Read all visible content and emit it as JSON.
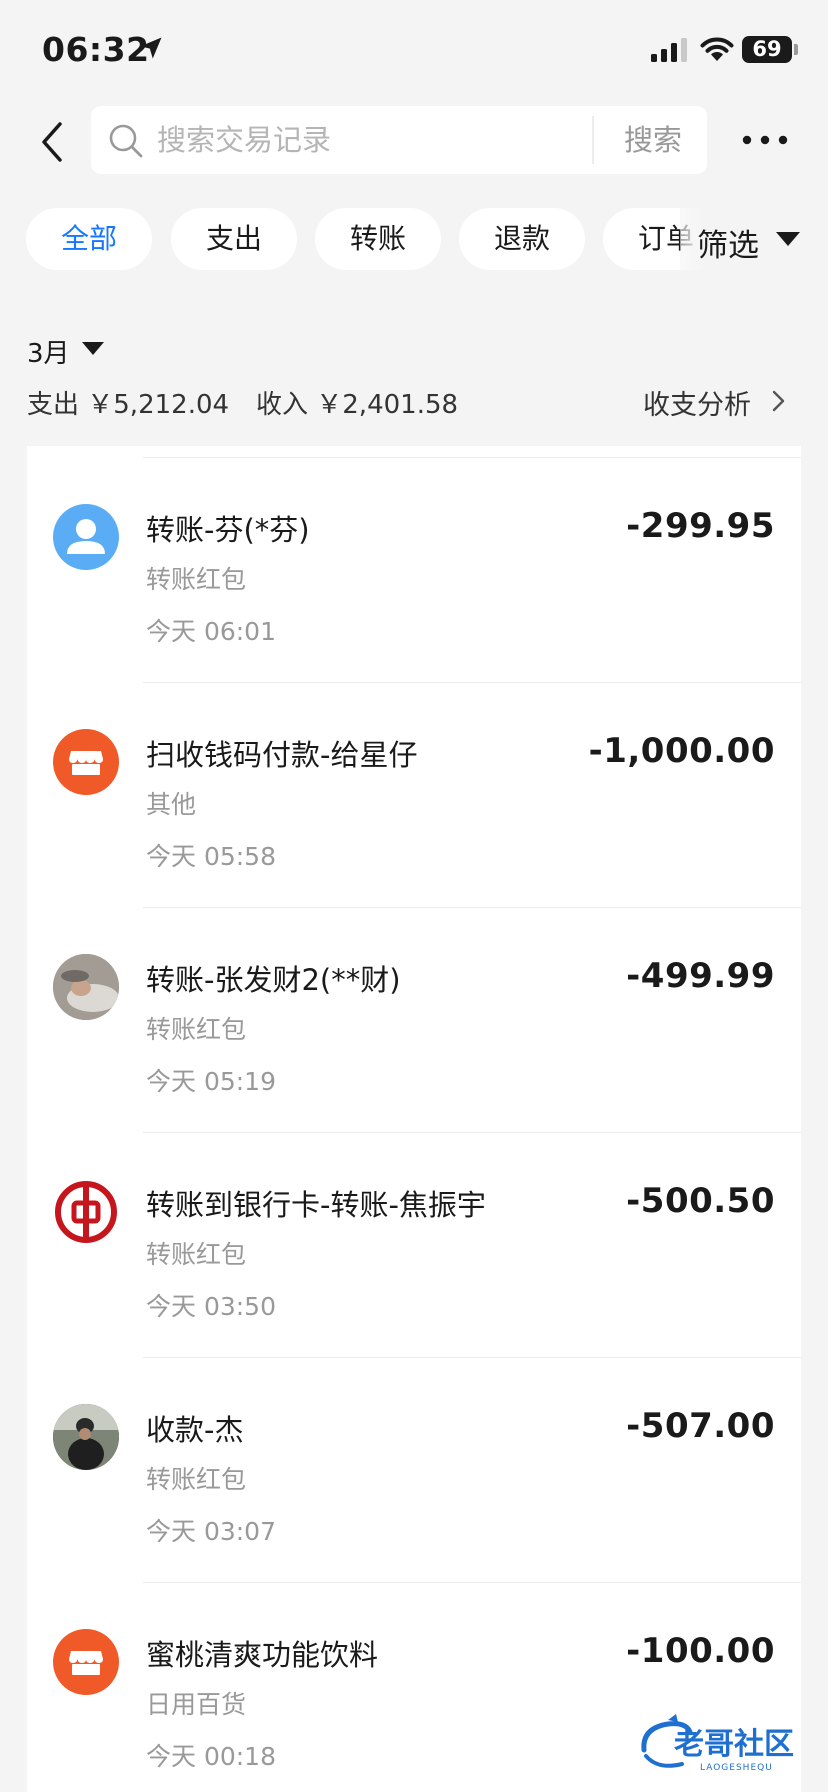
{
  "status_bar": {
    "time": "06:32",
    "battery": "69"
  },
  "header": {
    "search_placeholder": "搜索交易记录",
    "search_button": "搜索"
  },
  "tabs": [
    {
      "label": "全部",
      "active": true
    },
    {
      "label": "支出"
    },
    {
      "label": "转账"
    },
    {
      "label": "退款"
    },
    {
      "label": "订单"
    }
  ],
  "filter": {
    "label": "筛选"
  },
  "summary": {
    "month": "3月",
    "expense": "支出 ￥5,212.04",
    "income": "收入 ￥2,401.58",
    "analysis": "收支分析"
  },
  "transactions": [
    {
      "title": "转账-芬(*芬)",
      "category": "转账红包",
      "time": "今天 06:01",
      "amount": "-299.95",
      "icon": "person-avatar-icon"
    },
    {
      "title": "扫收钱码付款-给星仔",
      "category": "其他",
      "time": "今天 05:58",
      "amount": "-1,000.00",
      "icon": "store-icon"
    },
    {
      "title": "转账-张发财2(**财)",
      "category": "转账红包",
      "time": "今天 05:19",
      "amount": "-499.99",
      "icon": "user-photo-avatar"
    },
    {
      "title": "转账到银行卡-转账-焦振宇",
      "category": "转账红包",
      "time": "今天 03:50",
      "amount": "-500.50",
      "icon": "bank-of-china-logo"
    },
    {
      "title": "收款-杰",
      "category": "转账红包",
      "time": "今天 03:07",
      "amount": "-507.00",
      "icon": "user-photo-avatar"
    },
    {
      "title": "蜜桃清爽功能饮料",
      "category": "日用百货",
      "time": "今天 00:18",
      "amount": "-100.00",
      "icon": "store-icon"
    }
  ],
  "watermark": {
    "text": "老哥社区",
    "sub": "LAOGESHEQU"
  },
  "colors": {
    "accent": "#1677ff",
    "store": "#f05a28",
    "bank": "#c4161c",
    "person": "#5aadf5"
  }
}
